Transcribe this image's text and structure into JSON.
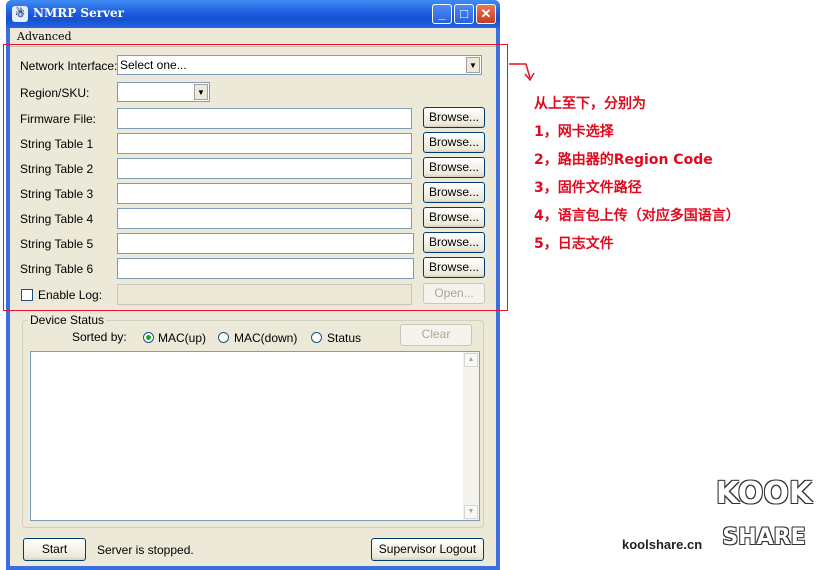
{
  "window": {
    "title": "NMRP Server",
    "app_icon": "app-icon",
    "controls": {
      "minimize": "_",
      "maximize": "□",
      "close": "✕"
    }
  },
  "menu": {
    "advanced": "Advanced"
  },
  "form": {
    "network_interface": {
      "label": "Network Interface:",
      "value": "Select one..."
    },
    "region": {
      "label": "Region/SKU:",
      "value": ""
    },
    "firmware": {
      "label": "Firmware File:",
      "button": "Browse..."
    },
    "string_tables": [
      {
        "label": "String Table  1",
        "button": "Browse..."
      },
      {
        "label": "String Table  2",
        "button": "Browse..."
      },
      {
        "label": "String Table  3",
        "button": "Browse..."
      },
      {
        "label": "String Table  4",
        "button": "Browse..."
      },
      {
        "label": "String Table  5",
        "button": "Browse..."
      },
      {
        "label": "String Table  6",
        "button": "Browse..."
      }
    ],
    "enable_log": {
      "label": "Enable Log:",
      "button": "Open..."
    }
  },
  "device_status": {
    "title": "Device Status",
    "sorted_by": "Sorted by:",
    "options": [
      "MAC(up)",
      "MAC(down)",
      "Status"
    ],
    "selected": "MAC(up)",
    "clear": "Clear"
  },
  "footer": {
    "start": "Start",
    "status": "Server is stopped.",
    "logout": "Supervisor  Logout"
  },
  "annotations": [
    "从上至下，分别为",
    "1，网卡选择",
    "2，路由器的Region Code",
    "3，固件文件路径",
    "4，语言包上传（对应多国语言）",
    "5，日志文件"
  ],
  "watermark": {
    "url": "koolshare.cn",
    "logo_top": "KOOK",
    "logo_bottom": "SHARE"
  },
  "colors": {
    "annotation": "#e00a1e",
    "titlebar": "#1d5ee0",
    "window_bg": "#ece9d8"
  }
}
